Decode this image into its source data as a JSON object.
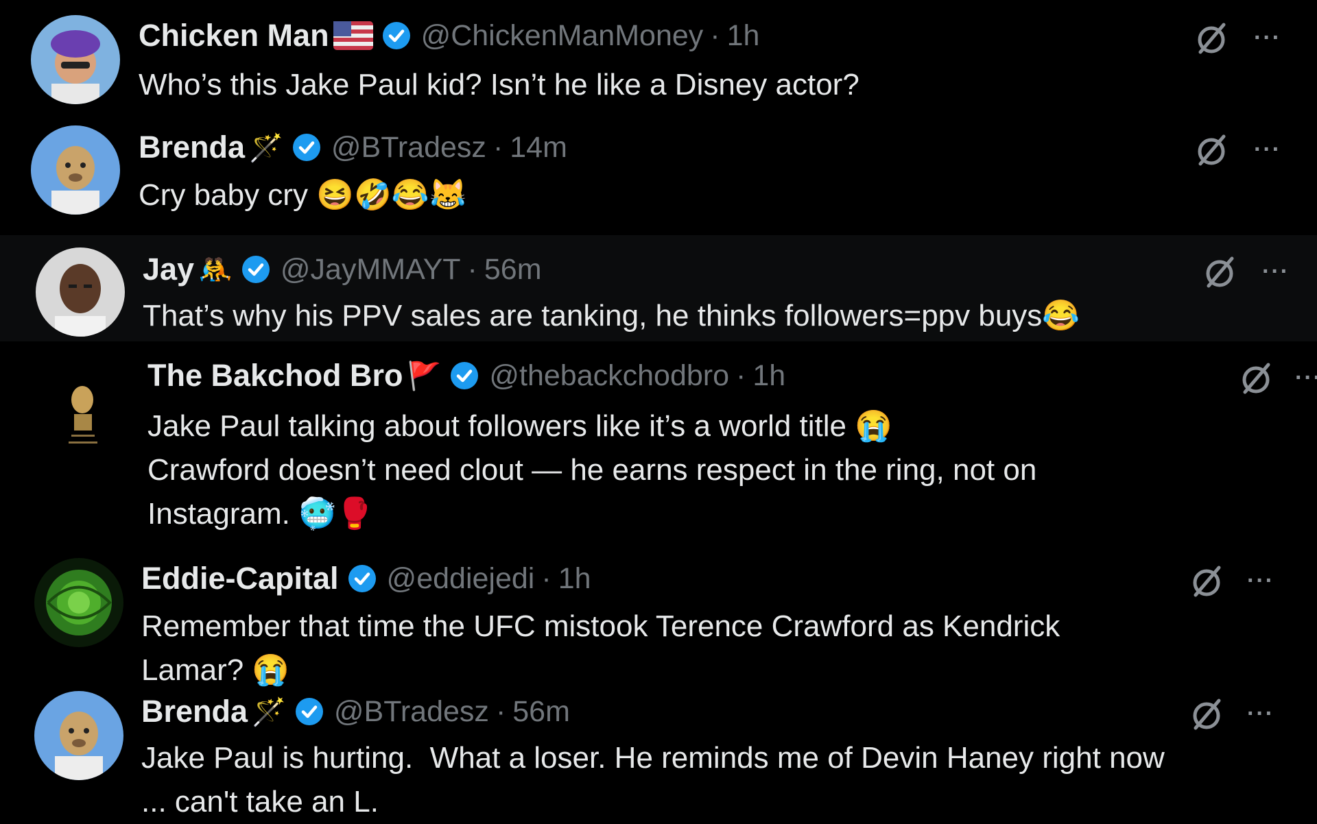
{
  "replies": [
    {
      "name": "Chicken Man",
      "decor": "🇺🇸",
      "handle": "@ChickenManMoney",
      "separator": "·",
      "time": "1h",
      "text": "Who’s this Jake Paul kid? Isn’t he like a Disney actor?",
      "grok_icon": "slashed-circle-icon",
      "more_label": "···"
    },
    {
      "name": "Brenda",
      "decor": "🪄",
      "handle": "@BTradesz",
      "separator": "·",
      "time": "14m",
      "text": "Cry baby cry 😆🤣😂😹",
      "grok_icon": "slashed-circle-icon",
      "more_label": "···"
    },
    {
      "name": "Jay",
      "decor": "🤼",
      "handle": "@JayMMAYT",
      "separator": "·",
      "time": "56m",
      "text": "That’s why his PPV sales are tanking, he thinks followers=ppv buys😂",
      "grok_icon": "slashed-circle-icon",
      "more_label": "···"
    },
    {
      "name": "The Bakchod Bro",
      "decor": "🚩",
      "handle": "@thebackchodbro",
      "separator": "·",
      "time": "1h",
      "text": "Jake Paul talking about followers like it’s a world title 😭\nCrawford doesn’t need clout — he earns respect in the ring, not on\nInstagram. 🥶🥊",
      "grok_icon": "slashed-circle-icon",
      "more_label": "···"
    },
    {
      "name": "Eddie-Capital",
      "decor": "",
      "handle": "@eddiejedi",
      "separator": "·",
      "time": "1h",
      "text": "Remember that time the UFC mistook Terence Crawford as Kendrick\nLamar? 😭",
      "grok_icon": "slashed-circle-icon",
      "more_label": "···"
    },
    {
      "name": "Brenda",
      "decor": "🪄",
      "handle": "@BTradesz",
      "separator": "·",
      "time": "56m",
      "text": "Jake Paul is hurting.  What a loser. He reminds me of Devin Haney right now\n... can't take an L.",
      "grok_icon": "slashed-circle-icon",
      "more_label": "···"
    }
  ],
  "colors": {
    "background": "#000000",
    "text": "#e7e9ea",
    "muted": "#71767b",
    "verified": "#1d9bf0",
    "highlight_row": "#0b0c0d"
  }
}
